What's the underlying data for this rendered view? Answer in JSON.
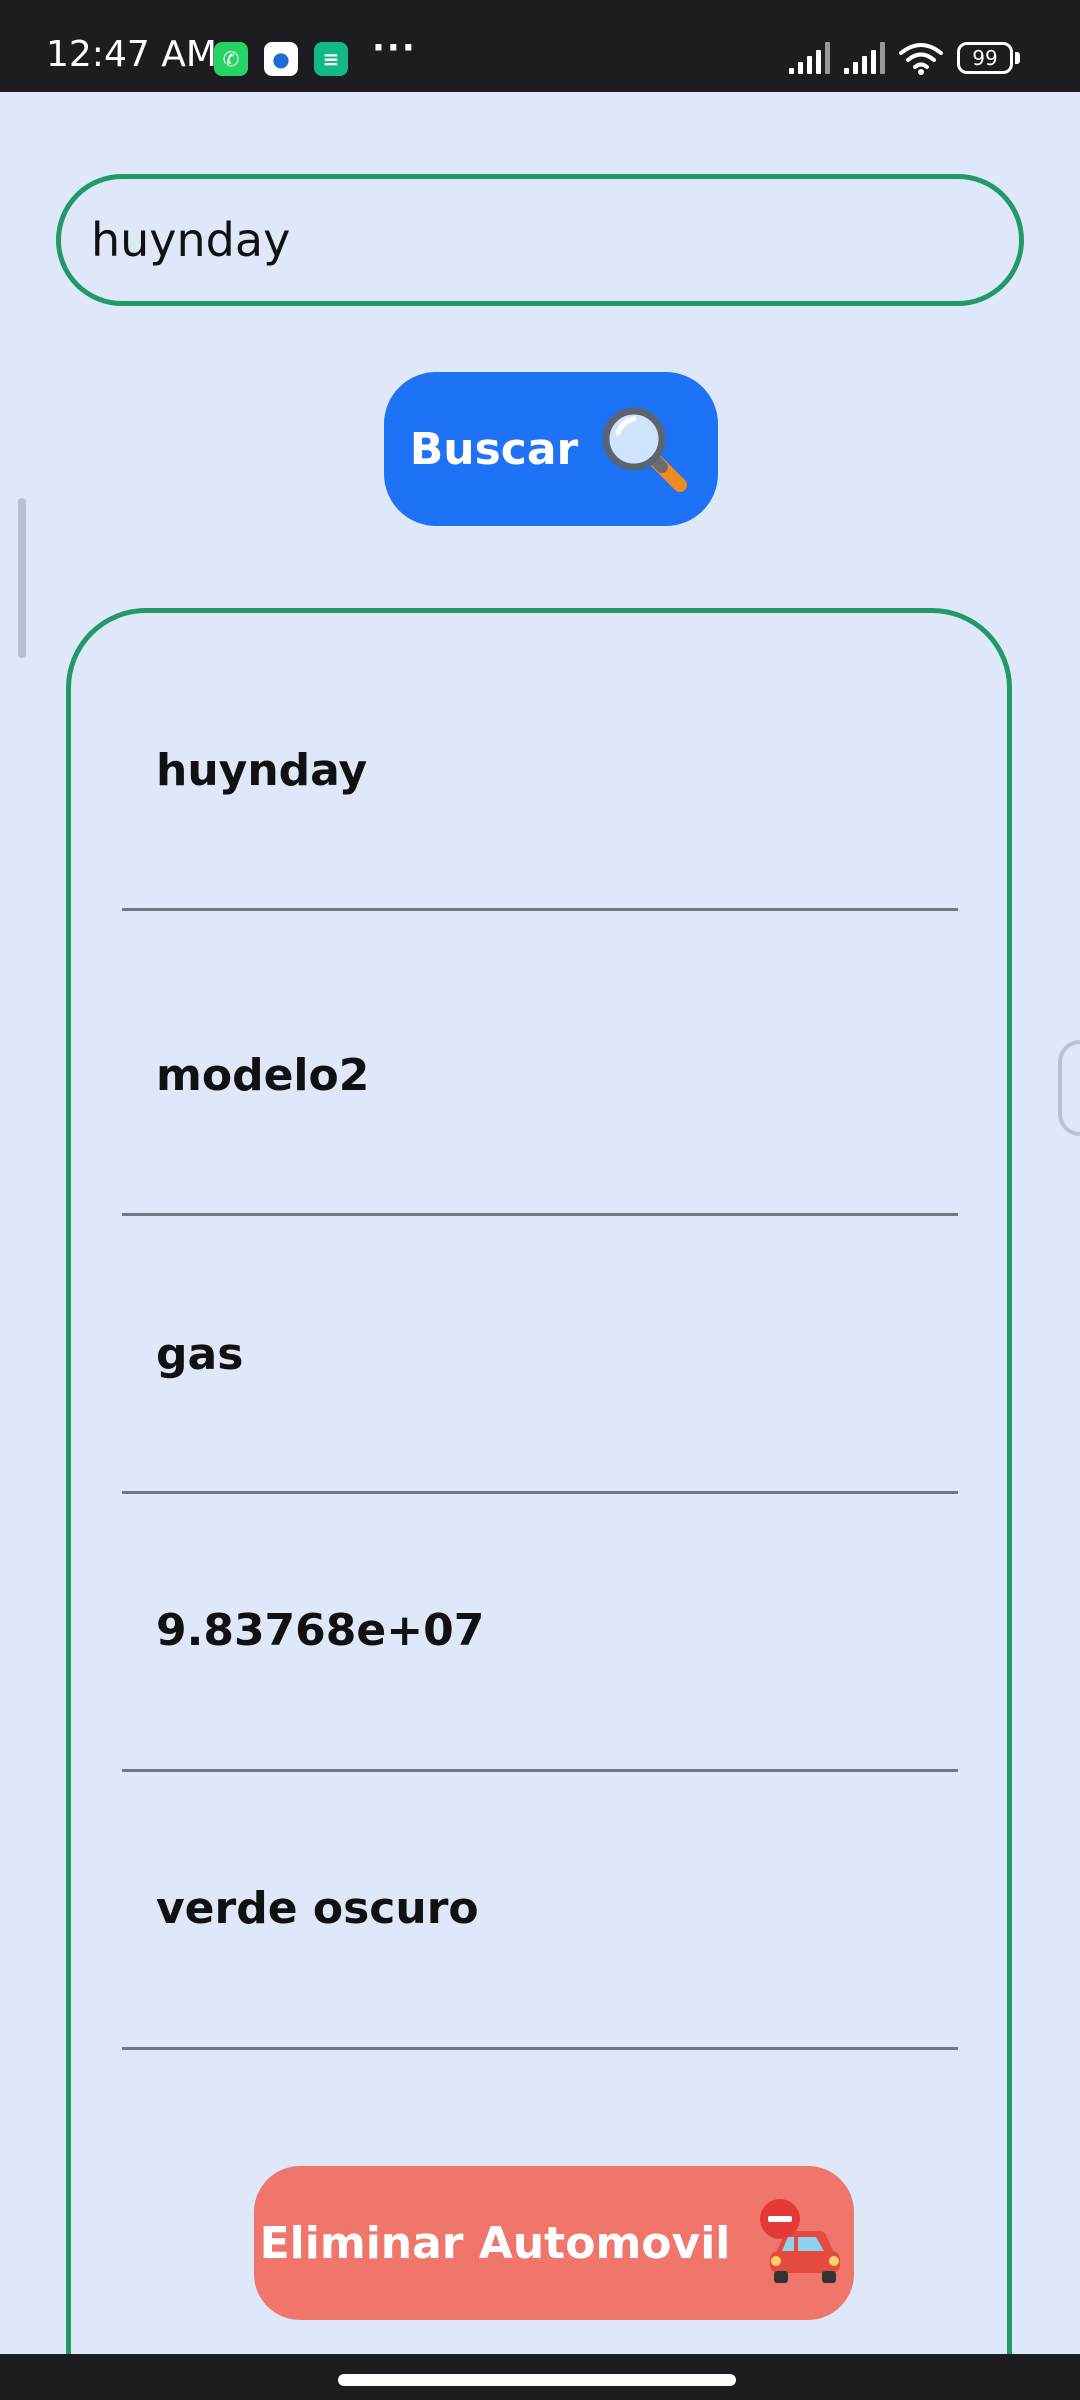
{
  "status_bar": {
    "time": "12:47 AM",
    "apps": [
      "whatsapp-icon",
      "messages-icon",
      "shortcut-app-icon"
    ],
    "more": "···",
    "battery": "99"
  },
  "search": {
    "value": "huynday",
    "button_label": "Buscar",
    "button_icon": "magnifying-glass-icon"
  },
  "details": {
    "fields": [
      "huynday",
      "modelo2",
      "gas",
      "9.83768e+07",
      "verde oscuro"
    ]
  },
  "actions": {
    "delete_label": "Eliminar Automovil",
    "delete_icon": "car-minus-icon"
  },
  "colors": {
    "accent_green": "#229966",
    "primary_blue": "#1e72f5",
    "danger_coral": "#f0756b",
    "background": "#dfe8f8"
  }
}
